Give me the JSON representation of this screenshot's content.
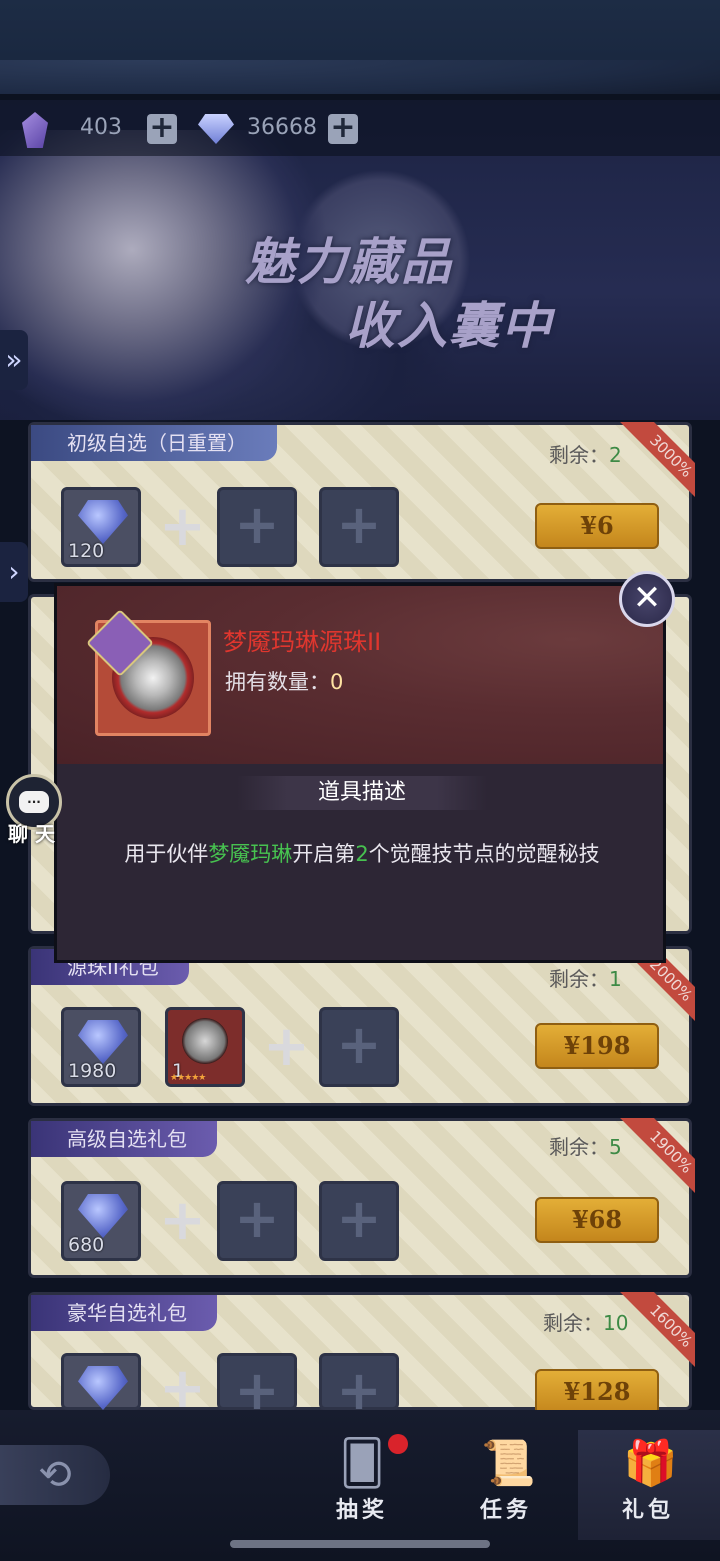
{
  "currency": {
    "crystal_value": "403",
    "diamond_value": "36668"
  },
  "banner": {
    "line1": "魅力藏品",
    "line2": "收入囊中"
  },
  "packs": [
    {
      "name": "初级自选（日重置）",
      "remain_label": "剩余：",
      "remain_value": "2",
      "ribbon": "3000%",
      "price": "¥6",
      "gem_qty": "120"
    },
    {
      "name": "源珠II礼包",
      "remain_label": "剩余：",
      "remain_value": "1",
      "ribbon": "2000%",
      "price": "¥198",
      "gem_qty": "1980",
      "item_qty": "1"
    },
    {
      "name": "高级自选礼包",
      "remain_label": "剩余：",
      "remain_value": "5",
      "ribbon": "1900%",
      "price": "¥68",
      "gem_qty": "680"
    },
    {
      "name": "豪华自选礼包",
      "remain_label": "剩余：",
      "remain_value": "10",
      "ribbon": "1600%",
      "price": "¥128"
    }
  ],
  "popup": {
    "item_name": "梦魇玛琳源珠II",
    "count_label": "拥有数量：",
    "count_value": "0",
    "section_title": "道具描述",
    "desc_part1": "用于伙伴",
    "desc_highlight1": "梦魇玛琳",
    "desc_part2": "开启第",
    "desc_highlight2": "2",
    "desc_part3": "个觉醒技节点的觉醒秘技"
  },
  "chat": {
    "label": "聊 天",
    "bubble": "..."
  },
  "nav": {
    "tabs": [
      {
        "label": "抽奖",
        "icon": "cards-icon"
      },
      {
        "label": "任务",
        "icon": "scroll-icon"
      },
      {
        "label": "礼包",
        "icon": "gift-icon"
      }
    ]
  },
  "colors": {
    "accent_gold": "#e3ae37",
    "item_name_red": "#e0362e",
    "highlight_green": "#47c250",
    "ribbon_red": "#c24a3e"
  }
}
